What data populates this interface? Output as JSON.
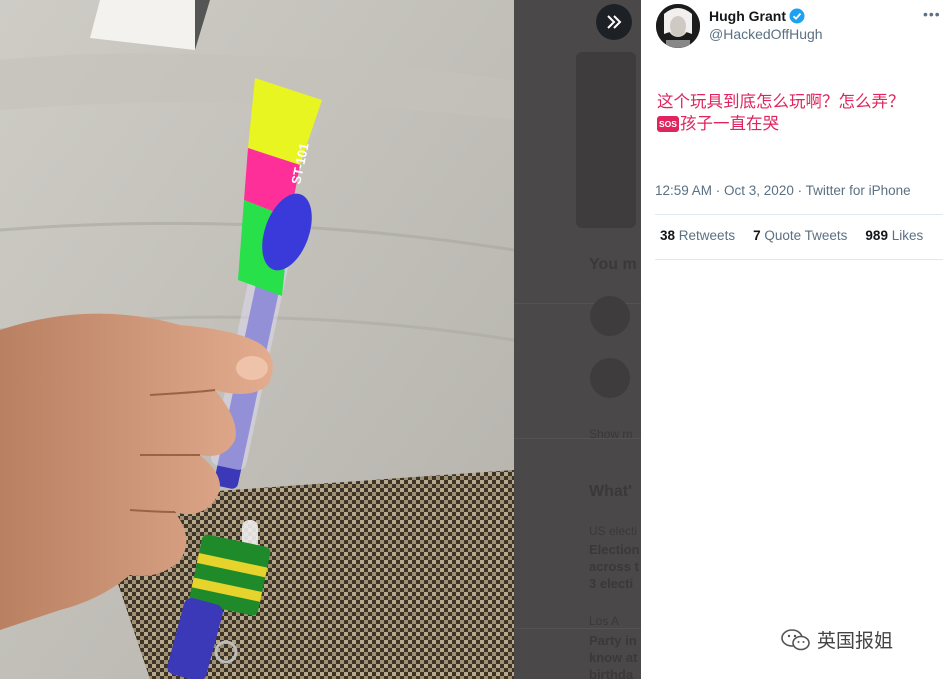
{
  "tweet": {
    "author_name": "Hugh Grant",
    "author_handle": "@HackedOffHugh",
    "text_line1": "这个玩具到底怎么玩啊？怎么弄？",
    "sos_badge": "SOS",
    "text_line2": "孩子一直在哭",
    "timestamp": "12:59 AM · Oct 3, 2020 · Twitter for iPhone",
    "retweets_count": "38",
    "retweets_label": "Retweets",
    "quote_count": "7",
    "quote_label": "Quote Tweets",
    "likes_count": "989",
    "likes_label": "Likes"
  },
  "background": {
    "you_might_like": "You m",
    "show_more": "Show m",
    "whats_happening": "What'",
    "trend1_category": "US electi",
    "trend1_title_1": "Election",
    "trend1_title_2": "across t",
    "trend1_title_3": "3 electi",
    "trend2_source": "Los A",
    "trend2_title_1": "Party in",
    "trend2_title_2": "know at",
    "trend2_title_3": "birthda"
  },
  "toy_label": "ST-101",
  "watermark": "英国报姐",
  "colors": {
    "accent_red": "#e0245e",
    "verified_blue": "#1da1f2",
    "muted_text": "#5b7083"
  },
  "icons": {
    "expand": "double-chevron-right-icon",
    "verified": "verified-badge-icon",
    "more": "more-horizontal-icon",
    "watermark": "wechat-icon"
  }
}
